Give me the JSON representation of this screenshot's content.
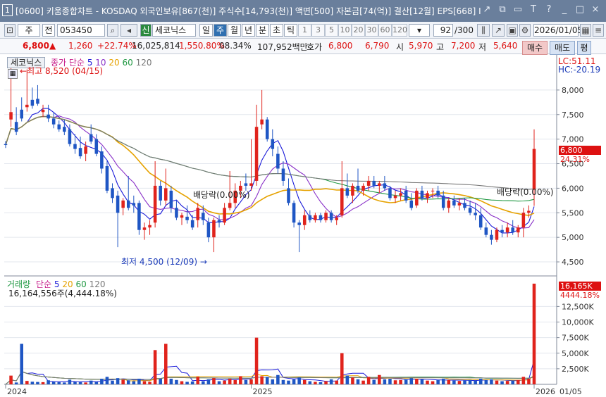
{
  "window": {
    "number": "1",
    "title": "[0600] 키움종합차트 - KOSDAQ 외국인보유[867(천)] 주식수[14,793(천)] 액면[500] 자본금[74(억)] 결산[12월] EPS[668] I",
    "buttons": [
      "↗",
      "⧉",
      "▭",
      "T",
      "?",
      "_",
      "□",
      "×"
    ]
  },
  "toolbar": {
    "type_label": "주",
    "all_label": "전",
    "code": "053450",
    "stock_badge": "신",
    "stock_name": "세코닉스",
    "periods": [
      "일",
      "주",
      "월",
      "년",
      "분",
      "초",
      "틱"
    ],
    "selected_period": "주",
    "minute_steps": [
      "1",
      "3",
      "5",
      "10",
      "20",
      "30",
      "60",
      "120"
    ],
    "page_counter": "92",
    "page_total": "/300",
    "date": "2026/01/05"
  },
  "quote": {
    "price": "6,800",
    "arrow": "▲",
    "change": "1,260",
    "change_pct": "+22.74%",
    "volume": "16,025,814",
    "volume_pct": "1,550.80%",
    "turnover": "08.34%",
    "amount": "107,952백만",
    "bid_label": "호가",
    "ask": "6,800",
    "bid": "6,790",
    "open_label": "시",
    "open": "5,970",
    "high_label": "고",
    "high": "7,200",
    "low_label": "저",
    "low": "5,640",
    "buy_label": "매수",
    "sell_label": "매도",
    "eval_label": "평"
  },
  "price_panel": {
    "stock_name": "세코닉스",
    "indicator_label": "종가 단순",
    "ma_periods": [
      "5",
      "10",
      "20",
      "60",
      "120"
    ],
    "ma_colors": [
      "#1a1ad8",
      "#8a32c8",
      "#e6a200",
      "#229944",
      "#777777"
    ],
    "high_annotation": "최고 8,520 (04/15)",
    "low_annotation": "최저 4,500 (12/09)",
    "dividend_label_1": "배당락(0.00%)",
    "dividend_label_2": "배당락(0.00%)",
    "lc": "LC:51.11",
    "hc": "HC:-20.19",
    "last_price": "6,800",
    "last_pct": "24.31%",
    "y_ticks": [
      "8,000",
      "7,500",
      "7,000",
      "6,500",
      "6,000",
      "5,500",
      "5,000",
      "4,500"
    ]
  },
  "volume_panel": {
    "label": "거래량",
    "indicator_label": "단순",
    "ma_periods": [
      "5",
      "20",
      "60",
      "120"
    ],
    "ma_colors": [
      "#1a1ad8",
      "#e6a200",
      "#229944",
      "#777777"
    ],
    "current_volume": "16,164,556주(4,444.18%)",
    "last_volume": "16,165K",
    "last_pct": "4444.18%",
    "y_ticks": [
      "12,500K",
      "10,000K",
      "7,500K",
      "5,000K",
      "2,500K"
    ]
  },
  "x_axis": {
    "labels": [
      "2024",
      "2025",
      "2026",
      "01/05"
    ]
  },
  "chart_data": {
    "type": "candlestick",
    "xlabel": "",
    "ylabel": "",
    "ylim": [
      4300,
      8500
    ],
    "volume_ylim": [
      0,
      16500000
    ],
    "candles": [
      {
        "o": 6900,
        "h": 6960,
        "l": 6820,
        "c": 6880,
        "v": 0
      },
      {
        "o": 7400,
        "h": 8520,
        "l": 7250,
        "c": 7550,
        "v": 1400000
      },
      {
        "o": 7350,
        "h": 7650,
        "l": 7080,
        "c": 7150,
        "v": 300000
      },
      {
        "o": 7600,
        "h": 7850,
        "l": 7360,
        "c": 7420,
        "v": 6500000
      },
      {
        "o": 7650,
        "h": 8420,
        "l": 7560,
        "c": 7700,
        "v": 550000
      },
      {
        "o": 7800,
        "h": 8050,
        "l": 7620,
        "c": 7680,
        "v": 420000
      },
      {
        "o": 7820,
        "h": 8100,
        "l": 7680,
        "c": 7720,
        "v": 380000
      },
      {
        "o": 7550,
        "h": 7700,
        "l": 7450,
        "c": 7600,
        "v": 350000
      },
      {
        "o": 7500,
        "h": 7700,
        "l": 7350,
        "c": 7420,
        "v": 650000
      },
      {
        "o": 7420,
        "h": 7550,
        "l": 7220,
        "c": 7300,
        "v": 420000
      },
      {
        "o": 7300,
        "h": 7380,
        "l": 7150,
        "c": 7200,
        "v": 350000
      },
      {
        "o": 7250,
        "h": 7400,
        "l": 7080,
        "c": 7150,
        "v": 300000
      },
      {
        "o": 7200,
        "h": 7300,
        "l": 6850,
        "c": 6900,
        "v": 750000
      },
      {
        "o": 6900,
        "h": 7100,
        "l": 6700,
        "c": 6800,
        "v": 400000
      },
      {
        "o": 6820,
        "h": 7050,
        "l": 6600,
        "c": 6650,
        "v": 350000
      },
      {
        "o": 6700,
        "h": 6950,
        "l": 6550,
        "c": 6850,
        "v": 300000
      },
      {
        "o": 7100,
        "h": 7300,
        "l": 6900,
        "c": 6950,
        "v": 600000
      },
      {
        "o": 7000,
        "h": 7100,
        "l": 6650,
        "c": 6700,
        "v": 400000
      },
      {
        "o": 6750,
        "h": 6850,
        "l": 6300,
        "c": 6400,
        "v": 900000
      },
      {
        "o": 6450,
        "h": 6550,
        "l": 5900,
        "c": 5950,
        "v": 1200000
      },
      {
        "o": 6000,
        "h": 6100,
        "l": 5700,
        "c": 5800,
        "v": 600000
      },
      {
        "o": 5850,
        "h": 5950,
        "l": 4800,
        "c": 5500,
        "v": 1000000
      },
      {
        "o": 5600,
        "h": 5800,
        "l": 5450,
        "c": 5750,
        "v": 750000
      },
      {
        "o": 5750,
        "h": 6250,
        "l": 5550,
        "c": 5600,
        "v": 650000
      },
      {
        "o": 5700,
        "h": 5850,
        "l": 5500,
        "c": 5650,
        "v": 500000
      },
      {
        "o": 5700,
        "h": 5750,
        "l": 5050,
        "c": 5150,
        "v": 900000
      },
      {
        "o": 5150,
        "h": 5300,
        "l": 4950,
        "c": 5200,
        "v": 500000
      },
      {
        "o": 5200,
        "h": 5350,
        "l": 5050,
        "c": 5250,
        "v": 400000
      },
      {
        "o": 5300,
        "h": 6550,
        "l": 5200,
        "c": 6050,
        "v": 5500000
      },
      {
        "o": 6050,
        "h": 6150,
        "l": 5650,
        "c": 5750,
        "v": 900000
      },
      {
        "o": 5750,
        "h": 6400,
        "l": 5650,
        "c": 6000,
        "v": 6500000
      },
      {
        "o": 5950,
        "h": 6050,
        "l": 5500,
        "c": 5600,
        "v": 900000
      },
      {
        "o": 5600,
        "h": 5750,
        "l": 5350,
        "c": 5400,
        "v": 700000
      },
      {
        "o": 5400,
        "h": 5500,
        "l": 5250,
        "c": 5450,
        "v": 500000
      },
      {
        "o": 5420,
        "h": 5650,
        "l": 5280,
        "c": 5350,
        "v": 400000
      },
      {
        "o": 5350,
        "h": 5450,
        "l": 5150,
        "c": 5200,
        "v": 450000
      },
      {
        "o": 5350,
        "h": 5700,
        "l": 5200,
        "c": 5600,
        "v": 1200000
      },
      {
        "o": 5500,
        "h": 5650,
        "l": 5250,
        "c": 5350,
        "v": 500000
      },
      {
        "o": 5300,
        "h": 5400,
        "l": 4900,
        "c": 5000,
        "v": 800000
      },
      {
        "o": 5000,
        "h": 5400,
        "l": 4700,
        "c": 5350,
        "v": 1000000
      },
      {
        "o": 5350,
        "h": 5450,
        "l": 5200,
        "c": 5300,
        "v": 500000
      },
      {
        "o": 5300,
        "h": 5700,
        "l": 5250,
        "c": 5600,
        "v": 600000
      },
      {
        "o": 5600,
        "h": 6350,
        "l": 5550,
        "c": 5700,
        "v": 900000
      },
      {
        "o": 5700,
        "h": 6100,
        "l": 5600,
        "c": 5950,
        "v": 700000
      },
      {
        "o": 5950,
        "h": 6150,
        "l": 5800,
        "c": 6050,
        "v": 1300000
      },
      {
        "o": 6100,
        "h": 6300,
        "l": 5950,
        "c": 6050,
        "v": 700000
      },
      {
        "o": 6050,
        "h": 7000,
        "l": 5950,
        "c": 6100,
        "v": 800000
      },
      {
        "o": 6150,
        "h": 7700,
        "l": 6050,
        "c": 7250,
        "v": 7500000
      },
      {
        "o": 7300,
        "h": 8000,
        "l": 7200,
        "c": 7400,
        "v": 1300000
      },
      {
        "o": 7400,
        "h": 7450,
        "l": 6950,
        "c": 7000,
        "v": 1200000
      },
      {
        "o": 7000,
        "h": 7200,
        "l": 6650,
        "c": 6800,
        "v": 800000
      },
      {
        "o": 6700,
        "h": 6850,
        "l": 6300,
        "c": 6400,
        "v": 1500000
      },
      {
        "o": 6400,
        "h": 6550,
        "l": 6050,
        "c": 6150,
        "v": 700000
      },
      {
        "o": 6000,
        "h": 6200,
        "l": 5650,
        "c": 5700,
        "v": 600000
      },
      {
        "o": 5700,
        "h": 5750,
        "l": 5200,
        "c": 5300,
        "v": 800000
      },
      {
        "o": 5300,
        "h": 5350,
        "l": 4700,
        "c": 5250,
        "v": 1100000
      },
      {
        "o": 5250,
        "h": 5550,
        "l": 5150,
        "c": 5450,
        "v": 700000
      },
      {
        "o": 5450,
        "h": 5550,
        "l": 5300,
        "c": 5350,
        "v": 500000
      },
      {
        "o": 5350,
        "h": 5500,
        "l": 5300,
        "c": 5450,
        "v": 400000
      },
      {
        "o": 5450,
        "h": 5500,
        "l": 5300,
        "c": 5350,
        "v": 350000
      },
      {
        "o": 5350,
        "h": 5550,
        "l": 5300,
        "c": 5500,
        "v": 500000
      },
      {
        "o": 5500,
        "h": 5550,
        "l": 5300,
        "c": 5350,
        "v": 800000
      },
      {
        "o": 5350,
        "h": 5450,
        "l": 5250,
        "c": 5400,
        "v": 600000
      },
      {
        "o": 5450,
        "h": 6550,
        "l": 5400,
        "c": 6000,
        "v": 5000000
      },
      {
        "o": 6000,
        "h": 6300,
        "l": 5800,
        "c": 5850,
        "v": 1400000
      },
      {
        "o": 5850,
        "h": 6100,
        "l": 5700,
        "c": 6050,
        "v": 1100000
      },
      {
        "o": 6050,
        "h": 6400,
        "l": 5900,
        "c": 5950,
        "v": 800000
      },
      {
        "o": 5950,
        "h": 6100,
        "l": 5850,
        "c": 6050,
        "v": 600000
      },
      {
        "o": 6050,
        "h": 6250,
        "l": 5950,
        "c": 6150,
        "v": 1200000
      },
      {
        "o": 6150,
        "h": 6250,
        "l": 6000,
        "c": 6050,
        "v": 700000
      },
      {
        "o": 6050,
        "h": 6150,
        "l": 5900,
        "c": 6100,
        "v": 1500000
      },
      {
        "o": 6100,
        "h": 6250,
        "l": 5950,
        "c": 6000,
        "v": 800000
      },
      {
        "o": 6000,
        "h": 6050,
        "l": 5750,
        "c": 5800,
        "v": 900000
      },
      {
        "o": 5800,
        "h": 5950,
        "l": 5700,
        "c": 5850,
        "v": 650000
      },
      {
        "o": 5850,
        "h": 6000,
        "l": 5750,
        "c": 5900,
        "v": 700000
      },
      {
        "o": 5950,
        "h": 6050,
        "l": 5700,
        "c": 5750,
        "v": 800000
      },
      {
        "o": 5750,
        "h": 5900,
        "l": 5550,
        "c": 5600,
        "v": 1000000
      },
      {
        "o": 5650,
        "h": 6000,
        "l": 5600,
        "c": 5950,
        "v": 900000
      },
      {
        "o": 5950,
        "h": 6050,
        "l": 5750,
        "c": 5800,
        "v": 800000
      },
      {
        "o": 5800,
        "h": 5950,
        "l": 5700,
        "c": 5900,
        "v": 600000
      },
      {
        "o": 5950,
        "h": 6000,
        "l": 5800,
        "c": 5950,
        "v": 500000
      },
      {
        "o": 5950,
        "h": 6050,
        "l": 5800,
        "c": 5850,
        "v": 700000
      },
      {
        "o": 5850,
        "h": 5950,
        "l": 5550,
        "c": 5600,
        "v": 900000
      },
      {
        "o": 5600,
        "h": 5800,
        "l": 5500,
        "c": 5750,
        "v": 700000
      },
      {
        "o": 5750,
        "h": 5850,
        "l": 5600,
        "c": 5650,
        "v": 600000
      },
      {
        "o": 5650,
        "h": 5800,
        "l": 5550,
        "c": 5700,
        "v": 550000
      },
      {
        "o": 5700,
        "h": 5800,
        "l": 5550,
        "c": 5600,
        "v": 600000
      },
      {
        "o": 5600,
        "h": 5750,
        "l": 5450,
        "c": 5500,
        "v": 700000
      },
      {
        "o": 5500,
        "h": 5700,
        "l": 5350,
        "c": 5450,
        "v": 600000
      },
      {
        "o": 5450,
        "h": 5600,
        "l": 5150,
        "c": 5200,
        "v": 900000
      },
      {
        "o": 5200,
        "h": 5300,
        "l": 5000,
        "c": 5050,
        "v": 700000
      },
      {
        "o": 5050,
        "h": 5150,
        "l": 4850,
        "c": 4950,
        "v": 800000
      },
      {
        "o": 4950,
        "h": 5200,
        "l": 4900,
        "c": 5150,
        "v": 600000
      },
      {
        "o": 5150,
        "h": 5250,
        "l": 5000,
        "c": 5100,
        "v": 500000
      },
      {
        "o": 5100,
        "h": 5300,
        "l": 5000,
        "c": 5200,
        "v": 550000
      },
      {
        "o": 5200,
        "h": 5350,
        "l": 5050,
        "c": 5100,
        "v": 600000
      },
      {
        "o": 5100,
        "h": 5250,
        "l": 5000,
        "c": 5200,
        "v": 700000
      },
      {
        "o": 5200,
        "h": 5600,
        "l": 5000,
        "c": 5500,
        "v": 1200000
      },
      {
        "o": 5500,
        "h": 5650,
        "l": 5400,
        "c": 5540,
        "v": 900000
      },
      {
        "o": 5970,
        "h": 7200,
        "l": 5640,
        "c": 6800,
        "v": 16164556
      }
    ]
  }
}
